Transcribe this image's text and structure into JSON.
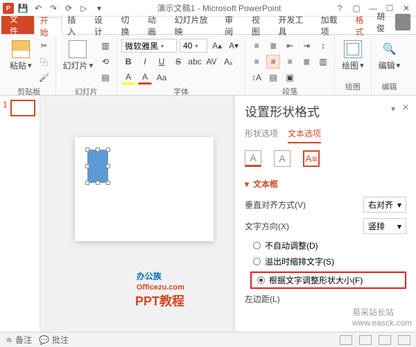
{
  "qat": {
    "title": "演示文稿1 - Microsoft PowerPoint"
  },
  "tabs": {
    "file": "文件",
    "home": "开始",
    "insert": "插入",
    "design": "设计",
    "transitions": "切换",
    "animations": "动画",
    "slideshow": "幻灯片放映",
    "review": "审阅",
    "view": "视图",
    "developer": "开发工具",
    "addins": "加载项",
    "format": "格式"
  },
  "user": {
    "name": "胡俊"
  },
  "ribbon": {
    "clipboard": {
      "paste": "粘贴",
      "label": "剪贴板"
    },
    "slides": {
      "btn": "幻灯片",
      "label": "幻灯片"
    },
    "font": {
      "name": "微软雅黑",
      "size": "40",
      "label": "字体"
    },
    "para": {
      "label": "段落"
    },
    "drawing": {
      "btn": "绘图",
      "label": "绘图"
    },
    "editing": {
      "btn": "编辑",
      "label": "编辑"
    }
  },
  "thumb": {
    "num": "1"
  },
  "watermark": {
    "brand": "办公族",
    "brand_sub": "Officezu.com",
    "ppt": "PPT教程",
    "site": "易采站长站",
    "url": "www.easck.com"
  },
  "pane": {
    "title": "设置形状格式",
    "tab_shape": "形状选项",
    "tab_text": "文本选项",
    "section": "文本框",
    "valign_label": "垂直对齐方式(V)",
    "valign_value": "右对齐",
    "dir_label": "文字方向(X)",
    "dir_value": "竖排",
    "r1": "不自动调整(D)",
    "r2": "溢出时缩排文字(S)",
    "r3": "根据文字调整形状大小(F)",
    "margin_label": "左边距(L)"
  },
  "status": {
    "notes": "备注",
    "comments": "批注"
  }
}
